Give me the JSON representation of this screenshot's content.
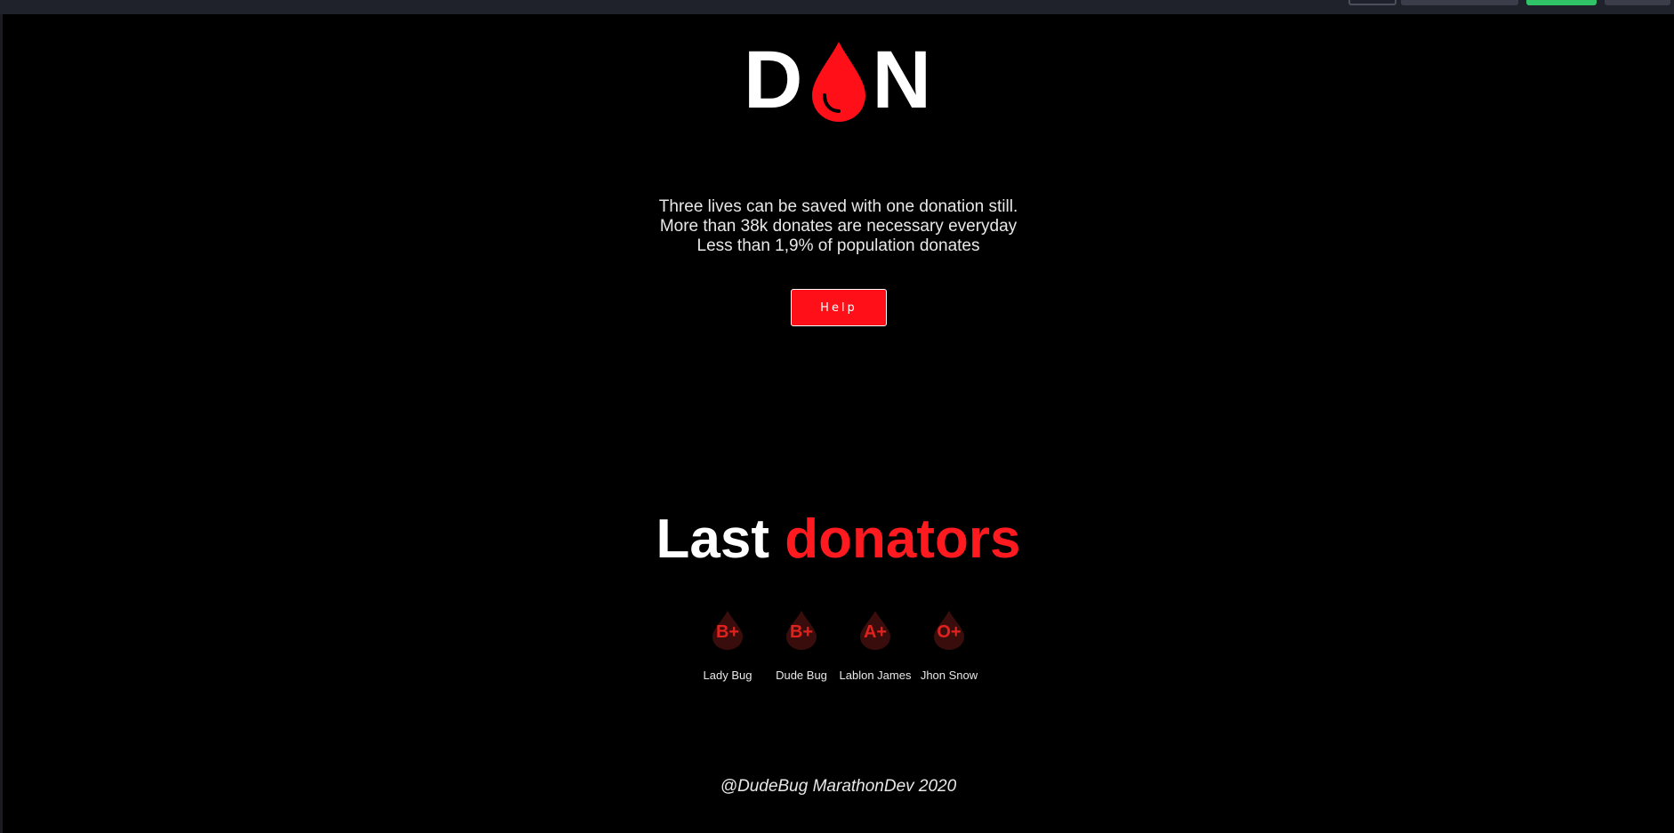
{
  "logo": {
    "left_letter": "D",
    "right_letter": "N",
    "brand_color": "#ff0f17"
  },
  "facts": [
    "Three lives can be saved with one donation still.",
    "More than 38k donates are necessary everyday",
    "Less than 1,9% of population donates"
  ],
  "help_button": {
    "label": "Help"
  },
  "last_donators": {
    "title_white": "Last",
    "title_red": "donators",
    "donors": [
      {
        "type": "B+",
        "name": "Lady Bug"
      },
      {
        "type": "B+",
        "name": "Dude Bug"
      },
      {
        "type": "A+",
        "name": "Lablon James"
      },
      {
        "type": "O+",
        "name": "Jhon Snow"
      }
    ]
  },
  "footer": {
    "text": "@DudeBug MarathonDev 2020"
  }
}
